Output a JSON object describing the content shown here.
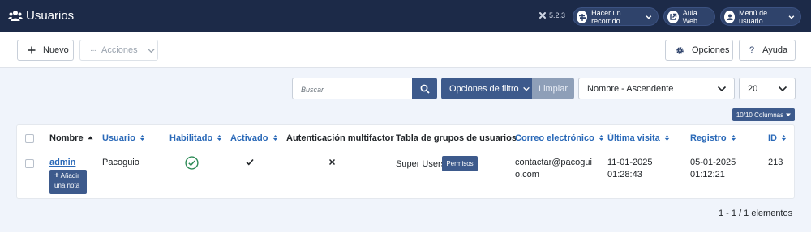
{
  "header": {
    "title": "Usuarios",
    "version": "5.2.3",
    "tour_label": "Hacer un recorrido",
    "aula_label": "Aula Web",
    "user_menu_label": "Menú de usuario"
  },
  "toolbar": {
    "new_label": "Nuevo",
    "actions_label": "Acciones",
    "options_label": "Opciones",
    "help_label": "Ayuda"
  },
  "filters": {
    "search_placeholder": "Buscar",
    "filter_options_label": "Opciones de filtro",
    "clear_label": "Limpiar",
    "sort_value": "Nombre - Ascendente",
    "limit_value": "20",
    "columns_label": "10/10 Columnas"
  },
  "table": {
    "columns": {
      "name": "Nombre",
      "username": "Usuario",
      "enabled": "Habilitado",
      "activated": "Activado",
      "mfa": "Autenticación multifactor",
      "groups": "Tabla de grupos de usuarios",
      "email": "Correo electrónico",
      "last_visit": "Última visita",
      "registered": "Registro",
      "id": "ID"
    },
    "rows": [
      {
        "name": "admin",
        "add_note": [
          "Añadir",
          "una nota"
        ],
        "username": "Pacoguio",
        "groups": "Super Users",
        "permissions_label": "Permisos",
        "email_lines": [
          "contactar@pacogui",
          "o.com"
        ],
        "last_visit_lines": [
          "11-01-2025",
          "01:28:43"
        ],
        "registered_lines": [
          "05-01-2025",
          "01:12:21"
        ],
        "id": "213"
      }
    ]
  },
  "pagination": {
    "summary": "1 - 1 / 1 elementos"
  },
  "colors": {
    "header_bg": "#1c2a48",
    "accent": "#3d5a8c",
    "link": "#2a69b8",
    "success": "#2e8b57"
  }
}
